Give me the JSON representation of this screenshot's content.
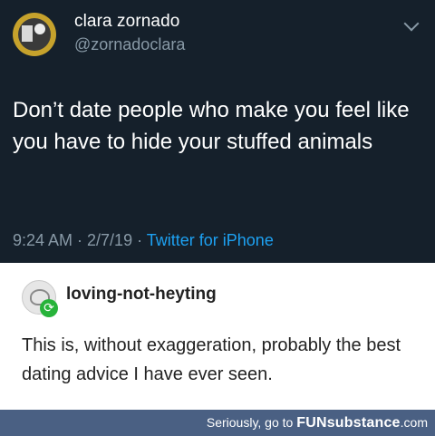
{
  "tweet": {
    "display_name": "clara zornado",
    "handle": "@zornadoclara",
    "text": "Don’t date people who make you feel like you have to hide your stuffed animals",
    "timestamp": "9:24 AM · 2/7/19 · ",
    "source": "Twitter for iPhone",
    "colors": {
      "background": "#15202b",
      "secondary": "#8899a6",
      "link": "#1da1f2"
    }
  },
  "reblog": {
    "username": "loving-not-heyting",
    "body": "This is, without exaggeration, probably the best dating advice I have ever seen.",
    "badge_icon": "reblog-icon",
    "badge_color": "#27b33a"
  },
  "footer": {
    "prefix": "Seriously, go to ",
    "brand": "FUNsubstance",
    "suffix": ".com",
    "background": "#4a6083"
  }
}
